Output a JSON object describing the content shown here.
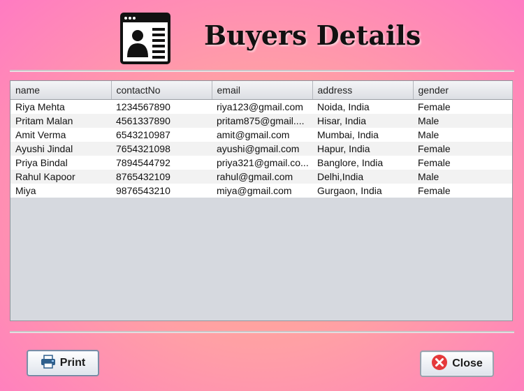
{
  "header": {
    "title": "Buyers Details",
    "logo_icon": "user-profile-card-icon"
  },
  "table": {
    "columns": [
      "name",
      "contactNo",
      "email",
      "address",
      "gender"
    ],
    "rows": [
      [
        "Riya Mehta",
        "1234567890",
        "riya123@gmail.com",
        "Noida, India",
        "Female"
      ],
      [
        "Pritam Malan",
        "4561337890",
        "pritam875@gmail....",
        "Hisar, India",
        "Male"
      ],
      [
        "Amit Verma",
        "6543210987",
        "amit@gmail.com",
        "Mumbai, India",
        "Male"
      ],
      [
        "Ayushi Jindal",
        "7654321098",
        "ayushi@gmail.com",
        "Hapur, India",
        "Female"
      ],
      [
        "Priya Bindal",
        "7894544792",
        "priya321@gmail.co...",
        "Banglore, India",
        "Female"
      ],
      [
        "Rahul Kapoor",
        "8765432109",
        "rahul@gmail.com",
        "Delhi,India",
        "Male"
      ],
      [
        "Miya",
        "9876543210",
        "miya@gmail.com",
        "Gurgaon, India",
        "Female"
      ]
    ]
  },
  "footer": {
    "print_label": "Print",
    "print_icon": "printer-icon",
    "close_label": "Close",
    "close_icon": "close-icon"
  },
  "colors": {
    "close_icon": "#e5393b",
    "printer_icon": "#2f5f8c"
  }
}
